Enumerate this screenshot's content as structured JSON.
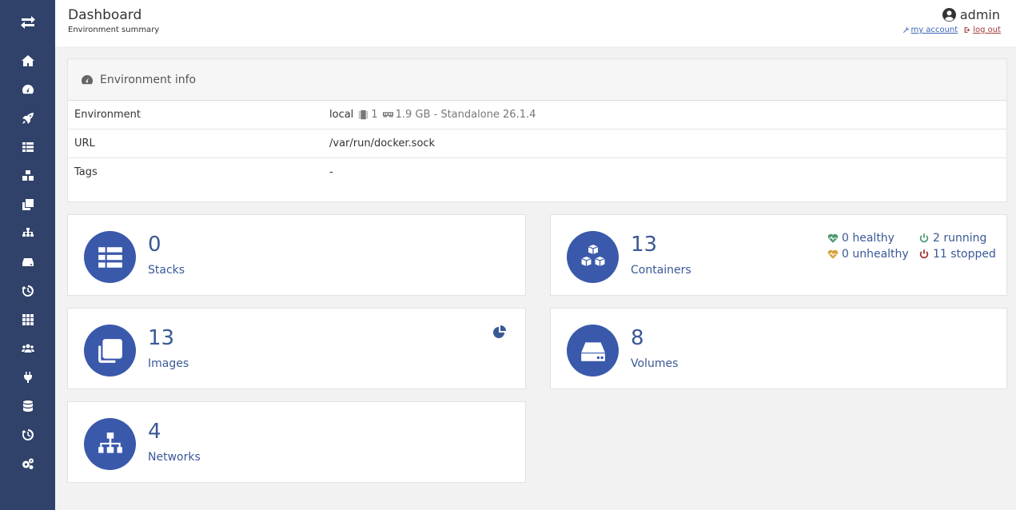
{
  "header": {
    "title": "Dashboard",
    "subtitle": "Environment summary",
    "username": "admin",
    "my_account_label": "my account",
    "logout_label": "log out"
  },
  "sidebar": {
    "items": [
      {
        "icon": "home-icon"
      },
      {
        "icon": "dashboard-gauge-icon"
      },
      {
        "icon": "rocket-icon"
      },
      {
        "icon": "th-list-icon"
      },
      {
        "icon": "cubes-icon"
      },
      {
        "icon": "clone-icon"
      },
      {
        "icon": "sitemap-icon"
      },
      {
        "icon": "hdd-icon"
      },
      {
        "icon": "history-icon"
      },
      {
        "icon": "th-icon"
      },
      {
        "icon": "users-icon"
      },
      {
        "icon": "plug-icon"
      },
      {
        "icon": "database-icon"
      },
      {
        "icon": "history-icon"
      },
      {
        "icon": "cogs-icon"
      }
    ]
  },
  "environment_panel": {
    "title": "Environment info",
    "rows": [
      {
        "label": "Environment",
        "value": "local",
        "cpu": "1",
        "memory": "1.9 GB - Standalone 26.1.4"
      },
      {
        "label": "URL",
        "value": "/var/run/docker.sock"
      },
      {
        "label": "Tags",
        "value": "-"
      }
    ]
  },
  "cards": {
    "stacks": {
      "count": "0",
      "label": "Stacks"
    },
    "containers": {
      "count": "13",
      "label": "Containers",
      "healthy": "0 healthy",
      "unhealthy": "0 unhealthy",
      "running": "2 running",
      "stopped": "11 stopped"
    },
    "images": {
      "count": "13",
      "label": "Images"
    },
    "volumes": {
      "count": "8",
      "label": "Volumes"
    },
    "networks": {
      "count": "4",
      "label": "Networks"
    }
  },
  "colors": {
    "sidebar": "#30426a",
    "accent": "#3a59ab",
    "healthy": "#4c9a73",
    "unhealthy": "#d9a13a",
    "running": "#4c9a73",
    "stopped": "#a13131"
  }
}
